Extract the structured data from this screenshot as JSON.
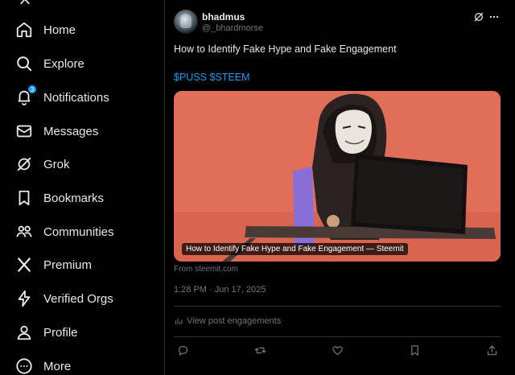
{
  "sidebar": {
    "items": [
      {
        "label": "Home",
        "icon": "home-icon",
        "active": false
      },
      {
        "label": "Explore",
        "icon": "search-icon"
      },
      {
        "label": "Notifications",
        "icon": "bell-icon",
        "badge": "3"
      },
      {
        "label": "Messages",
        "icon": "envelope-icon"
      },
      {
        "label": "Grok",
        "icon": "grok-icon"
      },
      {
        "label": "Bookmarks",
        "icon": "bookmark-icon"
      },
      {
        "label": "Communities",
        "icon": "people-icon"
      },
      {
        "label": "Premium",
        "icon": "x-logo-icon"
      },
      {
        "label": "Verified Orgs",
        "icon": "lightning-icon"
      },
      {
        "label": "Profile",
        "icon": "person-icon"
      },
      {
        "label": "More",
        "icon": "more-circle-icon"
      }
    ]
  },
  "post": {
    "author_name": "bhadmus",
    "author_handle": "@_bhardmorse",
    "text": "How to Identify Fake Hype and Fake Engagement",
    "hashtags": "$PUSS $STEEM",
    "card": {
      "caption": "How to Identify Fake Hype and Fake Engagement — Steemit",
      "from": "From steemit.com"
    },
    "timestamp": "1:28 PM · Jun 17, 2025",
    "engagements_label": "View post engagements"
  },
  "colors": {
    "background": "#000000",
    "text": "#e7e9ea",
    "muted": "#71767b",
    "accent": "#1d9bf0",
    "divider": "#2f3336",
    "card_bg": "#e0705a"
  }
}
